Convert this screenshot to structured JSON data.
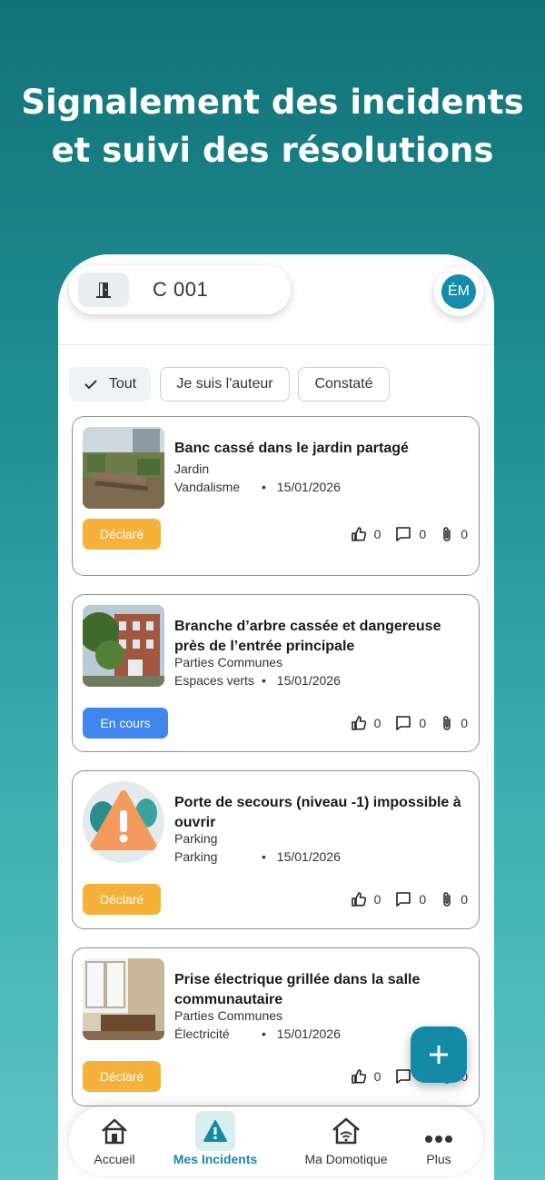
{
  "headline": {
    "line1": "Signalement des incidents",
    "line2": "et suivi des résolutions"
  },
  "topbar": {
    "unit": "C 001",
    "avatar_initials": "ÉM",
    "unit_icon": "door-icon"
  },
  "filters": [
    {
      "label": "Tout",
      "selected": true
    },
    {
      "label": "Je suis l'auteur",
      "selected": false
    },
    {
      "label": "Constaté",
      "selected": false
    }
  ],
  "incidents": [
    {
      "title": "Banc cassé dans le jardin partagé",
      "location": "Jardin",
      "category": "Vandalisme",
      "date": "15/01/2026",
      "status": "Déclaré",
      "likes": "0",
      "comments": "0",
      "attachments": "0"
    },
    {
      "title": "Branche d’arbre cassée et dangereuse près de l’entrée principale",
      "location": "Parties Communes",
      "category": "Espaces verts",
      "date": "15/01/2026",
      "status": "En cours",
      "likes": "0",
      "comments": "0",
      "attachments": "0"
    },
    {
      "title": "Porte de secours (niveau -1) impossible à ouvrir",
      "location": "Parking",
      "category": "Parking",
      "date": "15/01/2026",
      "status": "Déclaré",
      "likes": "0",
      "comments": "0",
      "attachments": "0"
    },
    {
      "title": "Prise électrique grillée dans la salle communautaire",
      "location": "Parties Communes",
      "category": "Électricité",
      "date": "15/01/2026",
      "status": "Déclaré",
      "likes": "0",
      "comments": "0",
      "attachments": "0"
    }
  ],
  "date_separator": "•",
  "nav": [
    {
      "label": "Accueil",
      "icon": "home-icon"
    },
    {
      "label": "Mes Incidents",
      "icon": "warning-icon",
      "active": true
    },
    {
      "label": "Ma Domotique",
      "icon": "smart-home-icon"
    },
    {
      "label": "Plus",
      "icon": "more-icon"
    }
  ],
  "colors": {
    "accent": "#148aa7",
    "declared": "#f5b13a",
    "in_progress": "#3e86ee"
  }
}
